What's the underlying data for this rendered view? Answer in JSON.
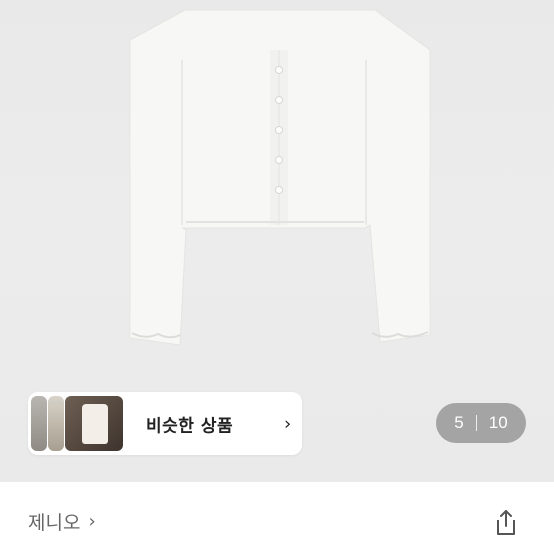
{
  "similar_products": {
    "label": "비슷한 상품",
    "chevron": "›"
  },
  "image_counter": {
    "current": "5",
    "total": "10"
  },
  "seller": {
    "name": "제니오",
    "chevron": "›"
  },
  "icons": {
    "share": "share-icon",
    "chevron": "chevron-right-icon"
  }
}
